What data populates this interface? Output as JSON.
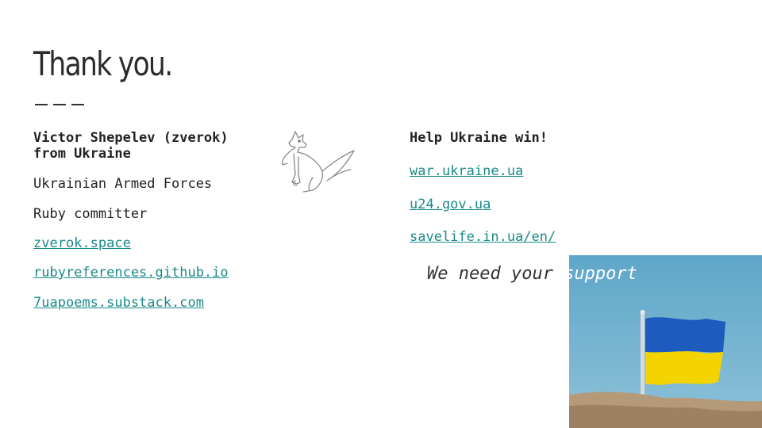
{
  "slide": {
    "title": "Thank you."
  },
  "left_column": {
    "name_line1": "Victor Shepelev (zverok)",
    "name_line2": "from Ukraine",
    "affiliation": "Ukrainian Armed Forces",
    "role": "Ruby committer",
    "links": [
      "zverok.space",
      "rubyreferences.github.io",
      "7uapoems.substack.com"
    ]
  },
  "right_column": {
    "heading": "Help Ukraine win!",
    "links": [
      "war.ukraine.ua",
      "u24.gov.ua",
      "savelife.in.ua/en/"
    ]
  },
  "support": {
    "text_dark": "We need your ",
    "text_light": "support"
  },
  "colors": {
    "link": "#1a8a8a",
    "sky": "#5ea6c9",
    "flag_blue": "#1d5bbf",
    "flag_yellow": "#f4d400"
  },
  "icons": {
    "mascot": "dog-sketch-icon"
  }
}
